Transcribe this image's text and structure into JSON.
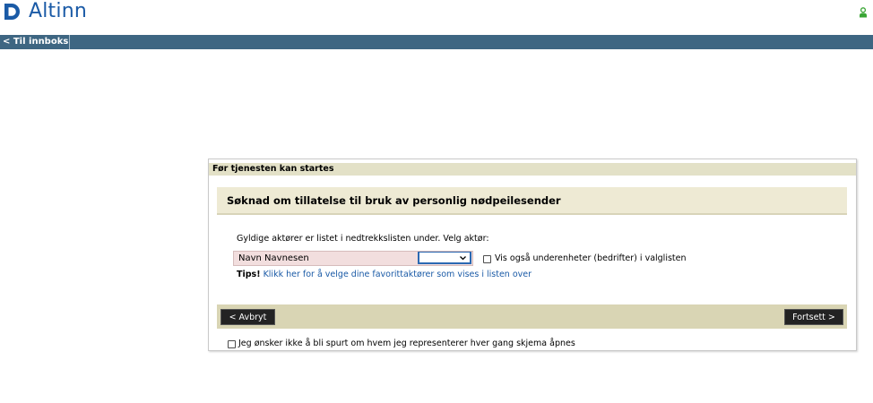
{
  "header": {
    "logo_text": "Altinn",
    "brand_color": "#1a5aa6",
    "user_icon": "user-icon",
    "user_icon_color": "#3aa635"
  },
  "navbar": {
    "back_label": "< Til innboks",
    "bar_color": "#3e6682"
  },
  "dialog": {
    "header": "Før tjenesten kan startes",
    "form_title": "Søknad om tillatelse til bruk av personlig nødpeilesender",
    "instruction": "Gyldige aktører er listet i nedtrekkslisten under. Velg aktør:",
    "actor_select": {
      "value": "Navn Navnesen"
    },
    "show_subunits": {
      "label": "Vis også underenheter (bedrifter) i valglisten",
      "checked": false
    },
    "tips": {
      "prefix": "Tips!",
      "link_text": "Klikk her for å velge dine favorittaktører som vises i listen over"
    },
    "cancel_label": "< Avbryt",
    "continue_label": "Fortsett >",
    "dont_ask": {
      "label": "Jeg ønsker ikke å bli spurt om hvem jeg representerer hver gang skjema åpnes",
      "checked": false
    }
  }
}
